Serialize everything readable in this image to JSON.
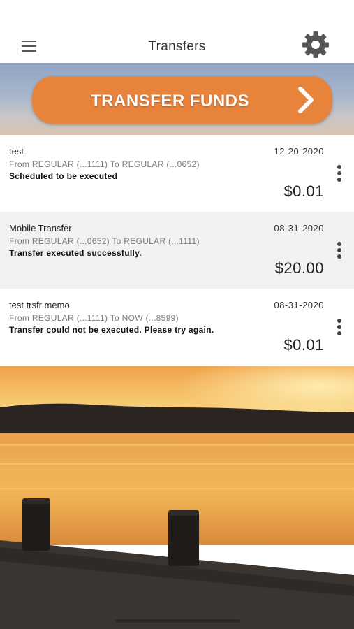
{
  "header": {
    "title": "Transfers",
    "menu_icon": "hamburger-menu-icon",
    "settings_icon": "gear-icon"
  },
  "banner": {
    "button_label": "TRANSFER FUNDS",
    "button_color": "#e8833c",
    "button_icon": "chevron-right-icon"
  },
  "transfers": [
    {
      "memo": "test",
      "date": "12-20-2020",
      "route": "From REGULAR (...1111) To REGULAR (...0652)",
      "status": "Scheduled to be executed",
      "amount": "$0.01"
    },
    {
      "memo": "Mobile Transfer",
      "date": "08-31-2020",
      "route": "From REGULAR (...0652) To REGULAR (...1111)",
      "status": "Transfer executed successfully.",
      "amount": "$20.00"
    },
    {
      "memo": "test trsfr memo",
      "date": "08-31-2020",
      "route": "From REGULAR (...1111) To NOW (...8599)",
      "status": "Transfer could not be executed. Please try again.",
      "amount": "$0.01"
    }
  ],
  "colors": {
    "accent": "#e8833c",
    "row_alt_background": "#f2f2f2"
  }
}
